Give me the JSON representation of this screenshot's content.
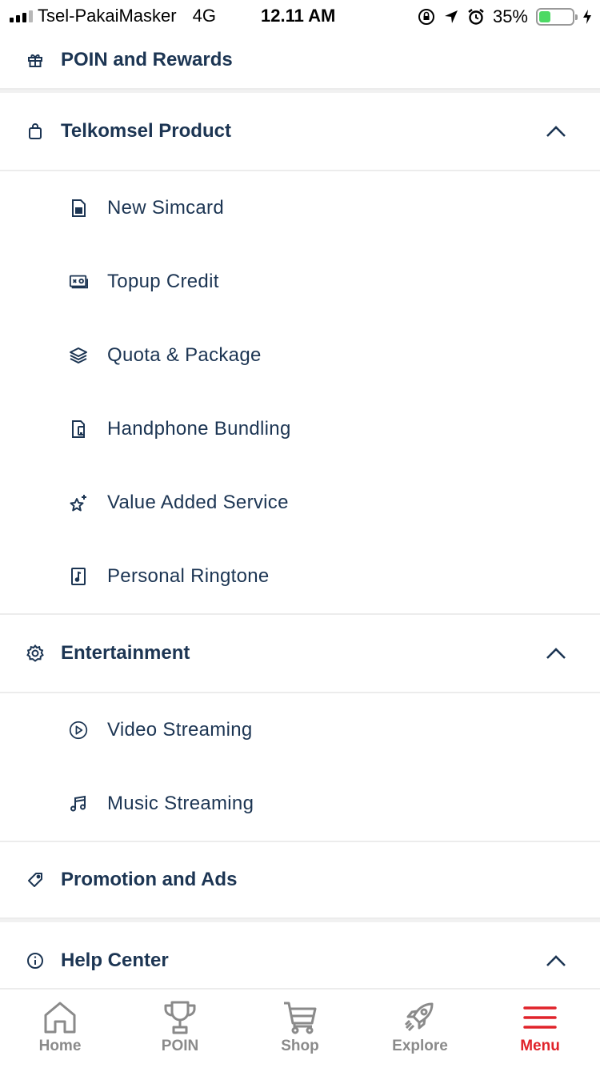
{
  "status_bar": {
    "carrier": "Tsel-PakaiMasker",
    "network": "4G",
    "time": "12.11 AM",
    "battery_percent": "35%",
    "battery_level": 0.35
  },
  "menu": {
    "poin_rewards": {
      "label": "POIN and Rewards",
      "icon": "gift-icon"
    },
    "telkomsel_product": {
      "label": "Telkomsel Product",
      "icon": "bag-icon",
      "expanded": true,
      "items": [
        {
          "label": "New Simcard",
          "icon": "simcard-icon"
        },
        {
          "label": "Topup Credit",
          "icon": "voucher-icon"
        },
        {
          "label": "Quota & Package",
          "icon": "layers-icon"
        },
        {
          "label": "Handphone Bundling",
          "icon": "phone-bundle-icon"
        },
        {
          "label": "Value Added Service",
          "icon": "sparkle-star-icon"
        },
        {
          "label": "Personal Ringtone",
          "icon": "music-file-icon"
        }
      ]
    },
    "entertainment": {
      "label": "Entertainment",
      "icon": "gear-icon",
      "expanded": true,
      "items": [
        {
          "label": "Video Streaming",
          "icon": "play-circle-icon"
        },
        {
          "label": "Music Streaming",
          "icon": "music-note-icon"
        }
      ]
    },
    "promotion": {
      "label": "Promotion and Ads",
      "icon": "tag-icon"
    },
    "help_center": {
      "label": "Help Center",
      "icon": "info-icon",
      "expanded": true
    }
  },
  "bottom_nav": {
    "items": [
      {
        "label": "Home",
        "icon": "home-icon"
      },
      {
        "label": "POIN",
        "icon": "trophy-icon"
      },
      {
        "label": "Shop",
        "icon": "cart-icon"
      },
      {
        "label": "Explore",
        "icon": "rocket-icon"
      },
      {
        "label": "Menu",
        "icon": "hamburger-icon"
      }
    ],
    "active": "Menu",
    "active_color": "#e0232a",
    "inactive_color": "#8a8a8a"
  },
  "colors": {
    "text": "#1c3553",
    "divider": "#ececec"
  }
}
